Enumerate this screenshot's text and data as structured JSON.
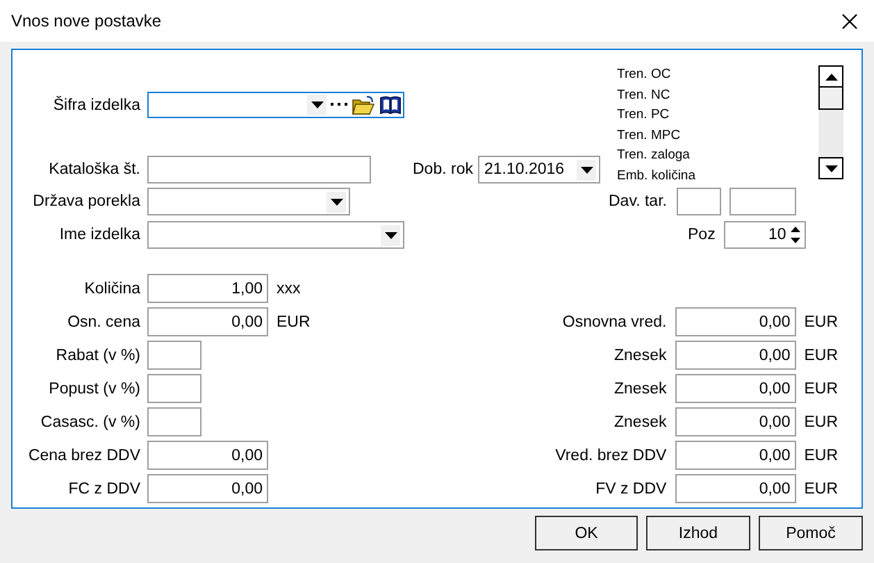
{
  "window": {
    "title": "Vnos nove postavke"
  },
  "product_code": {
    "label": "Šifra izdelka",
    "focused": true
  },
  "catalog_no": {
    "label": "Kataloška št."
  },
  "delivery_date": {
    "label": "Dob. rok",
    "value": "21.10.2016"
  },
  "info_list": {
    "items": [
      "Tren. OC",
      "Tren. NC",
      "Tren. PC",
      "Tren. MPC",
      "Tren. zaloga",
      "Emb. količina"
    ]
  },
  "country": {
    "label": "Država porekla"
  },
  "tax": {
    "label": "Dav. tar."
  },
  "product_name": {
    "label": "Ime izdelka"
  },
  "position": {
    "label": "Poz",
    "value": "10"
  },
  "amount_rows": [
    {
      "left": {
        "kind": "amount",
        "label": "Količina",
        "value": "1,00",
        "unit": "xxx"
      }
    },
    {
      "left": {
        "kind": "amount",
        "label": "Osn. cena",
        "value": "0,00",
        "unit": "EUR"
      },
      "right": {
        "label": "Osnovna vred.",
        "value": "0,00",
        "unit": "EUR"
      }
    },
    {
      "left": {
        "kind": "percent",
        "label": "Rabat (v %)"
      },
      "right": {
        "label": "Znesek",
        "value": "0,00",
        "unit": "EUR"
      }
    },
    {
      "left": {
        "kind": "percent",
        "label": "Popust (v %)"
      },
      "right": {
        "label": "Znesek",
        "value": "0,00",
        "unit": "EUR"
      }
    },
    {
      "left": {
        "kind": "percent",
        "label": "Casasc. (v %)"
      },
      "right": {
        "label": "Znesek",
        "value": "0,00",
        "unit": "EUR"
      }
    },
    {
      "left": {
        "kind": "amount",
        "label": "Cena brez DDV",
        "value": "0,00"
      },
      "right": {
        "label": "Vred. brez DDV",
        "value": "0,00",
        "unit": "EUR"
      }
    },
    {
      "left": {
        "kind": "amount",
        "label": "FC z DDV",
        "value": "0,00"
      },
      "right": {
        "label": "FV z DDV",
        "value": "0,00",
        "unit": "EUR"
      }
    }
  ],
  "buttons": [
    {
      "label": "OK"
    },
    {
      "label": "Izhod"
    },
    {
      "label": "Pomoč"
    }
  ]
}
